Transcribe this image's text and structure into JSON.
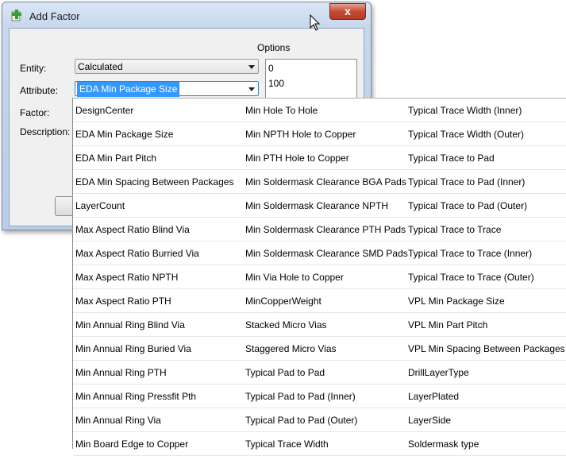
{
  "window": {
    "title": "Add Factor",
    "close_glyph": "x"
  },
  "form": {
    "entity_label": "Entity:",
    "entity_value": "Calculated",
    "attribute_label": "Attribute:",
    "attribute_value": "EDA Min Package Size",
    "factor_label": "Factor:",
    "description_label": "Description:",
    "options_label": "Options",
    "options": [
      "0",
      "100"
    ]
  },
  "dropdown": {
    "column1": [
      "DesignCenter",
      "EDA Min Package Size",
      "EDA Min Part Pitch",
      "EDA Min Spacing Between Packages",
      "LayerCount",
      "Max Aspect Ratio Blind Via",
      "Max Aspect Ratio Burried Via",
      "Max Aspect Ratio NPTH",
      "Max Aspect Ratio PTH",
      "Min Annual Ring Blind Via",
      "Min Annual Ring Buried Via",
      "Min Annual Ring PTH",
      "Min Annual Ring Pressfit Pth",
      "Min Annual Ring Via",
      "Min Board Edge to Copper"
    ],
    "column2": [
      "Min Hole To Hole",
      "Min NPTH Hole to Copper",
      "Min PTH Hole to Copper",
      "Min Soldermask Clearance BGA Pads",
      "Min Soldermask Clearance NPTH",
      "Min Soldermask Clearance PTH Pads",
      "Min Soldermask Clearance SMD Pads",
      "Min Via Hole to Copper",
      "MinCopperWeight",
      "Stacked Micro Vias",
      "Staggered Micro Vias",
      "Typical Pad to Pad",
      "Typical Pad to Pad (Inner)",
      "Typical Pad to Pad (Outer)",
      "Typical Trace Width"
    ],
    "column3": [
      "Typical Trace Width (Inner)",
      "Typical Trace Width (Outer)",
      "Typical Trace to Pad",
      "Typical Trace to Pad (Inner)",
      "Typical Trace to Pad (Outer)",
      "Typical Trace to Trace",
      "Typical Trace to Trace (Inner)",
      "Typical Trace to Trace (Outer)",
      "VPL Min Package Size",
      "VPL Min Part Pitch",
      "VPL Min Spacing Between Packages",
      "DrillLayerType",
      "LayerPlated",
      "LayerSide",
      "Soldermask type"
    ]
  },
  "colors": {
    "selection": "#3399ff",
    "close_button": "#c74a35"
  },
  "icons": {
    "app": "add-green-plus-icon",
    "cursor": "mouse-pointer-icon"
  }
}
